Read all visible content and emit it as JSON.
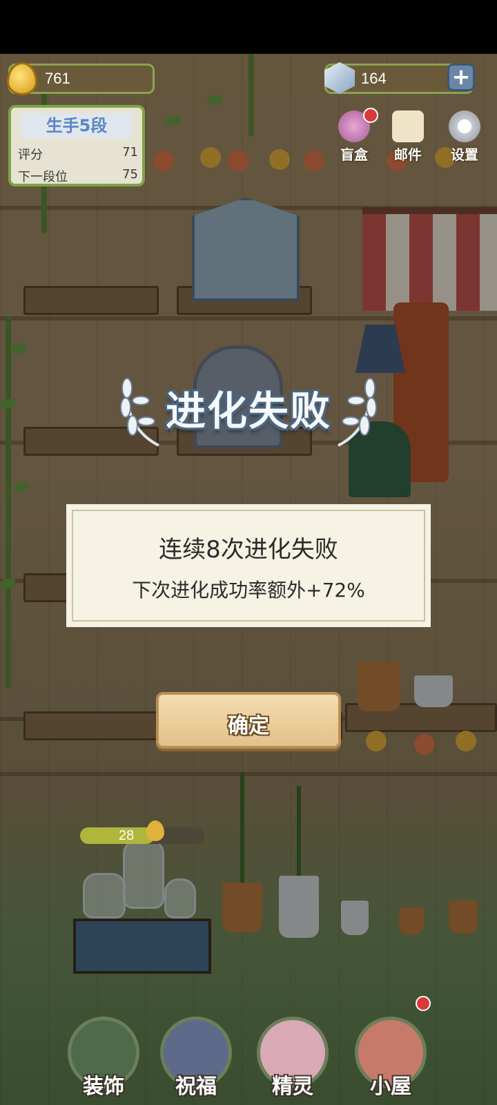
{
  "hud": {
    "coins": "761",
    "gems": "164",
    "plus_label": "+"
  },
  "rank": {
    "title": "生手5段",
    "score_label": "评分",
    "score_value": "71",
    "next_label": "下一段位",
    "next_value": "75"
  },
  "top_buttons": [
    {
      "label": "盲盒",
      "icon": "blind-box-icon"
    },
    {
      "label": "邮件",
      "icon": "mail-icon"
    },
    {
      "label": "设置",
      "icon": "gear-icon"
    }
  ],
  "banner": {
    "title": "进化失败"
  },
  "dialog": {
    "line1": "连续8次进化失败",
    "line2": "下次进化成功率额外+72%"
  },
  "confirm_label": "确定",
  "progress": {
    "value_text": "28",
    "fill_fraction": 0.6
  },
  "bottom_nav": [
    {
      "label": "装饰",
      "icon": "plant-icon"
    },
    {
      "label": "祝福",
      "icon": "butterfly-icon"
    },
    {
      "label": "精灵",
      "icon": "fairy-icon"
    },
    {
      "label": "小屋",
      "icon": "house-icon"
    }
  ],
  "colors": {
    "accent_green": "#7ea445",
    "rank_blue": "#5a86c2",
    "notify_red": "#d83a3a"
  }
}
